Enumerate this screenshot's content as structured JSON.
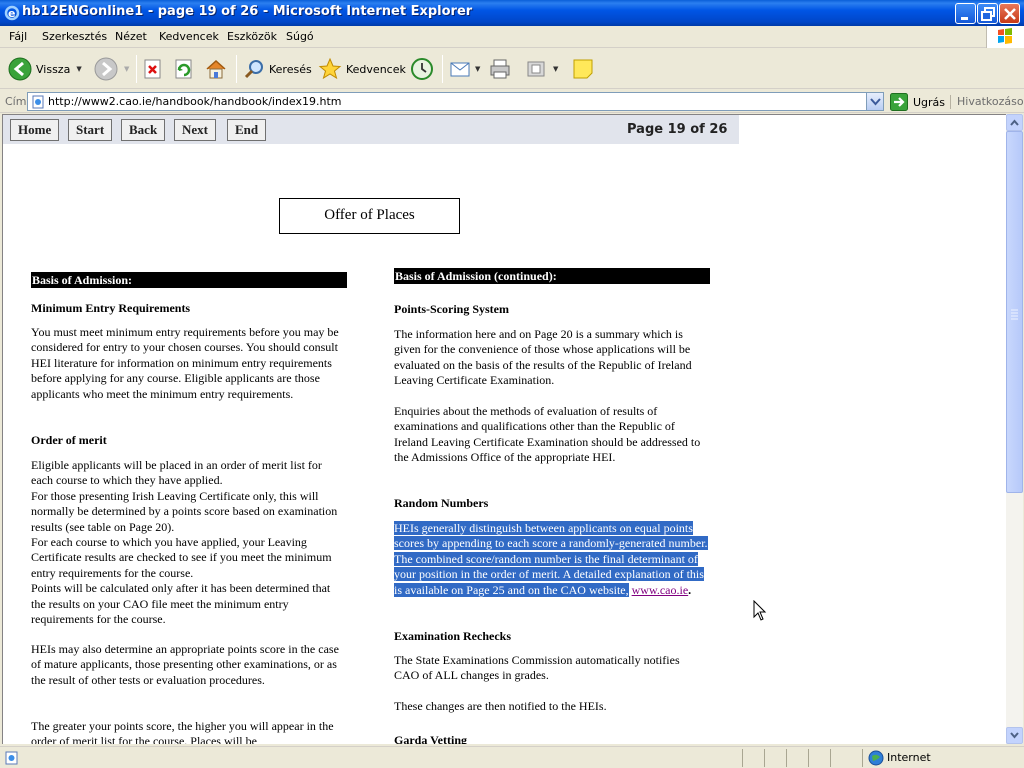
{
  "window": {
    "title": "hb12ENGonline1 - page 19 of 26 - Microsoft Internet Explorer"
  },
  "menu": [
    "Fájl",
    "Szerkesztés",
    "Nézet",
    "Kedvencek",
    "Eszközök",
    "Súgó"
  ],
  "toolbar": {
    "back_label": "Vissza",
    "search_label": "Keresés",
    "favorites_label": "Kedvencek"
  },
  "address": {
    "label": "Cím",
    "url": "http://www2.cao.ie/handbook/handbook/index19.htm",
    "go_label": "Ugrás",
    "links_label": "Hivatkozások"
  },
  "nav": {
    "home": "Home",
    "start": "Start",
    "back": "Back",
    "next": "Next",
    "end": "End",
    "page_info": "Page 19 of 26"
  },
  "page": {
    "heading": "Offer of Places",
    "left": {
      "bar": "Basis of Admission:",
      "min_entry_title": "Minimum Entry Requirements",
      "min_entry_text": "You must meet minimum entry requirements before you may be considered for entry to your chosen courses. You should consult HEI literature for information on minimum entry requirements before applying for any course. Eligible applicants are those applicants who meet the minimum entry requirements.",
      "order_title": "Order of merit",
      "order_p1": "Eligible applicants will be placed in an order of merit list for each course to which they have applied.",
      "order_p2": "For those presenting Irish Leaving Certificate only, this will normally be determined by a points score based on examination results (see table on Page 20).",
      "order_p3": "For each course to which you have applied, your Leaving Certificate results are checked to see if you meet the minimum entry requirements for the course.",
      "order_p4": "Points will be calculated only after it has been determined that the results on your CAO file meet the minimum entry requirements for the course.",
      "hei_text": "HEIs may also determine an appropriate points score in the case of mature applicants, those presenting other examinations, or as the result of other tests or evaluation procedures.",
      "greater_text": "The greater your points score, the higher you will appear in the order of merit list for the course. Places will be"
    },
    "right": {
      "bar": "Basis of Admission (continued):",
      "points_title": "Points-Scoring System",
      "points_text": "The information here and on Page 20 is a summary which is given for the convenience of those whose applications will be evaluated on the basis of the results of the Republic of Ireland Leaving Certificate Examination.",
      "enquiries_text": "Enquiries about the methods of evaluation of results of examinations and qualifications other than the Republic of Ireland Leaving Certificate Examination should be addressed to the Admissions Office of the appropriate HEI.",
      "random_title": "Random Numbers",
      "random_text": "HEIs generally distinguish between applicants on equal points scores by appending to each score a randomly-generated number. The combined score/random number is the final determinant of your position in the order of merit. A detailed explanation of this is available on Page 25 and on the CAO website",
      "random_link": "www.cao.ie",
      "rechecks_title": "Examination Rechecks",
      "rechecks_p1": "The State Examinations Commission automatically notifies CAO of ALL changes in grades.",
      "rechecks_p2": "These changes are then notified to the HEIs.",
      "garda_title": "Garda Vetting"
    }
  },
  "status": {
    "zone": "Internet"
  }
}
